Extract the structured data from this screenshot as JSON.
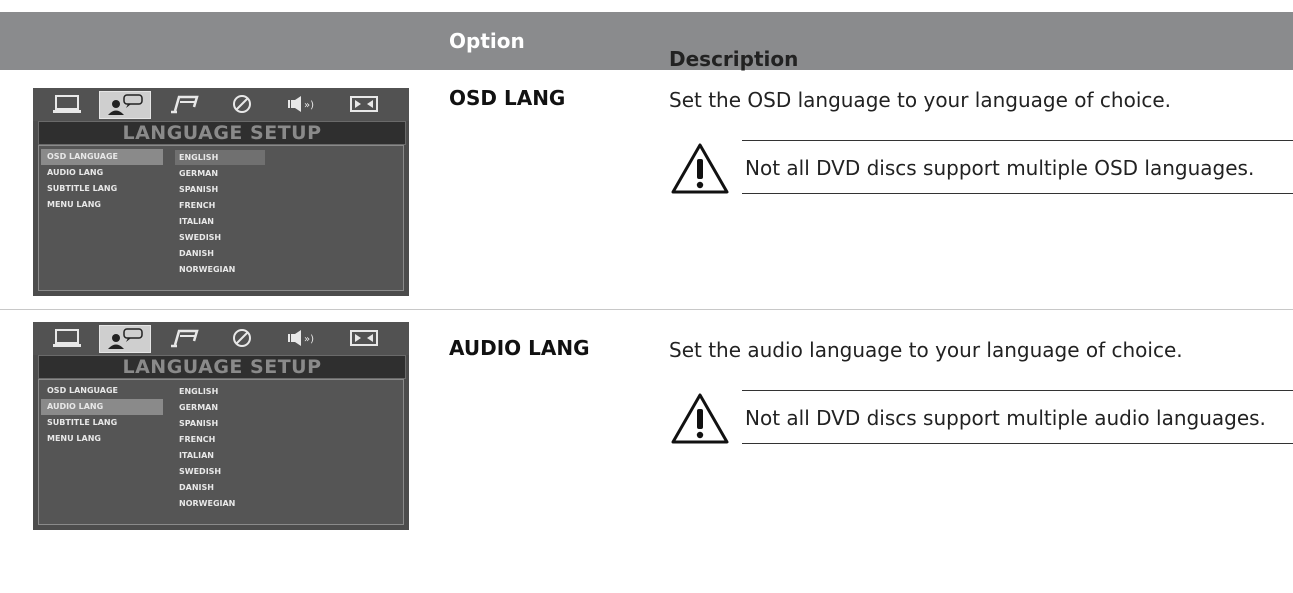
{
  "header": {
    "option": "Option",
    "description": "Description"
  },
  "rows": [
    {
      "option": "OSD LANG",
      "description": "Set the OSD language to your language of choice.",
      "warning": "Not all DVD discs support multiple OSD languages.",
      "screen": {
        "title": "LANGUAGE SETUP",
        "menu": [
          "OSD LANGUAGE",
          "AUDIO LANG",
          "SUBTITLE LANG",
          "MENU LANG"
        ],
        "selected_menu_index": 0,
        "languages": [
          "ENGLISH",
          "GERMAN",
          "SPANISH",
          "FRENCH",
          "ITALIAN",
          "SWEDISH",
          "DANISH",
          "NORWEGIAN"
        ],
        "selected_language_index": 0
      }
    },
    {
      "option": "AUDIO LANG",
      "description": "Set the audio language to your language of choice.",
      "warning": "Not all DVD discs support multiple audio languages.",
      "screen": {
        "title": "LANGUAGE SETUP",
        "menu": [
          "OSD LANGUAGE",
          "AUDIO LANG",
          "SUBTITLE LANG",
          "MENU LANG"
        ],
        "selected_menu_index": 1,
        "languages": [
          "ENGLISH",
          "GERMAN",
          "SPANISH",
          "FRENCH",
          "ITALIAN",
          "SWEDISH",
          "DANISH",
          "NORWEGIAN"
        ],
        "selected_language_index": -1
      }
    }
  ],
  "tab_icons": [
    "monitor-icon",
    "language-person-icon",
    "music-icon",
    "disc-icon",
    "speaker-icon",
    "dolby-icon"
  ],
  "colors": {
    "header_bg": "#8a8b8d",
    "osd_bg": "#4c4c4c",
    "text": "#222222"
  }
}
